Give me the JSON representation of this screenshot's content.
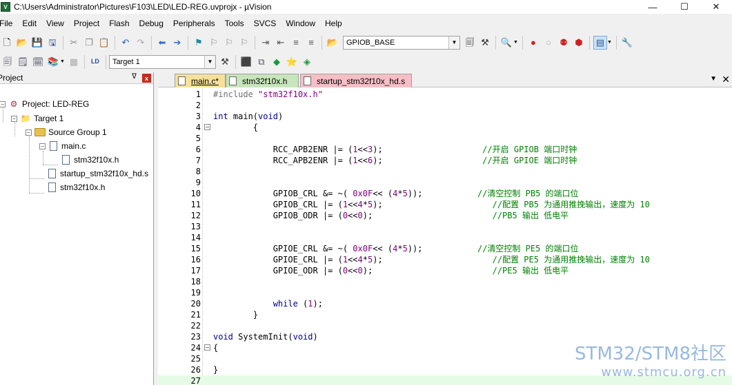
{
  "window": {
    "title": "C:\\Users\\Administrator\\Pictures\\F103\\LED\\LED-REG.uvprojx - µVision",
    "app_icon": "V",
    "min": "—",
    "max": "☐",
    "close": "✕"
  },
  "menu": [
    "File",
    "Edit",
    "View",
    "Project",
    "Flash",
    "Debug",
    "Peripherals",
    "Tools",
    "SVCS",
    "Window",
    "Help"
  ],
  "toolbar1": {
    "find_combo": "GPIOB_BASE"
  },
  "toolbar2": {
    "target_combo": "Target 1"
  },
  "project_panel": {
    "title": "Project",
    "pin": "ᐁ",
    "close": "x",
    "tree": [
      {
        "label": "Project: LED-REG",
        "level": 0,
        "type": "project"
      },
      {
        "label": "Target 1",
        "level": 1,
        "type": "target"
      },
      {
        "label": "Source Group 1",
        "level": 2,
        "type": "folder"
      },
      {
        "label": "main.c",
        "level": 3,
        "type": "file"
      },
      {
        "label": "stm32f10x.h",
        "level": 4,
        "type": "file"
      },
      {
        "label": "startup_stm32f10x_hd.s",
        "level": 3,
        "type": "file"
      },
      {
        "label": "stm32f10x.h",
        "level": 3,
        "type": "file"
      }
    ]
  },
  "tabs": [
    {
      "label": "main.c*"
    },
    {
      "label": "stm32f10x.h"
    },
    {
      "label": "startup_stm32f10x_hd.s"
    }
  ],
  "code": [
    {
      "n": "1",
      "parts": [
        [
          "pre",
          "#include "
        ],
        [
          "str",
          "\"stm32f10x.h\""
        ]
      ]
    },
    {
      "n": "2",
      "parts": []
    },
    {
      "n": "3",
      "parts": [
        [
          "kw",
          "int"
        ],
        [
          "",
          " main("
        ],
        [
          "kw",
          "void"
        ],
        [
          "",
          ")"
        ]
      ]
    },
    {
      "n": "4",
      "fold": true,
      "parts": [
        [
          "",
          "        {"
        ]
      ]
    },
    {
      "n": "5",
      "parts": []
    },
    {
      "n": "6",
      "parts": [
        [
          "",
          "            RCC_APB2ENR |= ("
        ],
        [
          "num",
          "1"
        ],
        [
          "",
          "<<"
        ],
        [
          "num",
          "3"
        ],
        [
          "",
          ");                    "
        ],
        [
          "comment",
          "//开启 GPIOB 端口时钟"
        ]
      ]
    },
    {
      "n": "7",
      "parts": [
        [
          "",
          "            RCC_APB2ENR |= ("
        ],
        [
          "num",
          "1"
        ],
        [
          "",
          "<<"
        ],
        [
          "num",
          "6"
        ],
        [
          "",
          ");                    "
        ],
        [
          "comment",
          "//开启 GPIOE 端口时钟"
        ]
      ]
    },
    {
      "n": "8",
      "parts": []
    },
    {
      "n": "9",
      "parts": []
    },
    {
      "n": "10",
      "parts": [
        [
          "",
          "            GPIOB_CRL &= ~( "
        ],
        [
          "num",
          "0x0F"
        ],
        [
          "",
          "<< ("
        ],
        [
          "num",
          "4"
        ],
        [
          "",
          "*"
        ],
        [
          "num",
          "5"
        ],
        [
          "",
          "));           "
        ],
        [
          "comment",
          "//清空控制 PB5 的端口位"
        ]
      ]
    },
    {
      "n": "11",
      "parts": [
        [
          "",
          "            GPIOB_CRL |= ("
        ],
        [
          "num",
          "1"
        ],
        [
          "",
          "<<"
        ],
        [
          "num",
          "4"
        ],
        [
          "",
          "*"
        ],
        [
          "num",
          "5"
        ],
        [
          "",
          ");                      "
        ],
        [
          "comment",
          "//配置 PB5 为通用推挽输出，速度为 10"
        ]
      ]
    },
    {
      "n": "12",
      "parts": [
        [
          "",
          "            GPIOB_ODR |= ("
        ],
        [
          "num",
          "0"
        ],
        [
          "",
          "<<"
        ],
        [
          "num",
          "0"
        ],
        [
          "",
          ");                        "
        ],
        [
          "comment",
          "//PB5 输出 低电平"
        ]
      ]
    },
    {
      "n": "13",
      "parts": []
    },
    {
      "n": "14",
      "parts": []
    },
    {
      "n": "15",
      "parts": [
        [
          "",
          "            GPIOE_CRL &= ~( "
        ],
        [
          "num",
          "0x0F"
        ],
        [
          "",
          "<< ("
        ],
        [
          "num",
          "4"
        ],
        [
          "",
          "*"
        ],
        [
          "num",
          "5"
        ],
        [
          "",
          "));           "
        ],
        [
          "comment",
          "//清空控制 PE5 的端口位"
        ]
      ]
    },
    {
      "n": "16",
      "parts": [
        [
          "",
          "            GPIOE_CRL |= ("
        ],
        [
          "num",
          "1"
        ],
        [
          "",
          "<<"
        ],
        [
          "num",
          "4"
        ],
        [
          "",
          "*"
        ],
        [
          "num",
          "5"
        ],
        [
          "",
          ");                      "
        ],
        [
          "comment",
          "//配置 PE5 为通用推挽输出，速度为 10"
        ]
      ]
    },
    {
      "n": "17",
      "parts": [
        [
          "",
          "            GPIOE_ODR |= ("
        ],
        [
          "num",
          "0"
        ],
        [
          "",
          "<<"
        ],
        [
          "num",
          "0"
        ],
        [
          "",
          ");                        "
        ],
        [
          "comment",
          "//PE5 输出 低电平"
        ]
      ]
    },
    {
      "n": "18",
      "parts": []
    },
    {
      "n": "19",
      "parts": []
    },
    {
      "n": "20",
      "parts": [
        [
          "",
          "            "
        ],
        [
          "kw",
          "while"
        ],
        [
          "",
          " ("
        ],
        [
          "num",
          "1"
        ],
        [
          "",
          ");"
        ]
      ]
    },
    {
      "n": "21",
      "parts": [
        [
          "",
          "        }"
        ]
      ]
    },
    {
      "n": "22",
      "parts": []
    },
    {
      "n": "23",
      "parts": [
        [
          "kw",
          "void"
        ],
        [
          "",
          " SystemInit("
        ],
        [
          "kw",
          "void"
        ],
        [
          "",
          ")"
        ]
      ]
    },
    {
      "n": "24",
      "fold": true,
      "parts": [
        [
          "",
          "{"
        ]
      ]
    },
    {
      "n": "25",
      "parts": []
    },
    {
      "n": "26",
      "parts": [
        [
          "",
          "}"
        ]
      ]
    },
    {
      "n": "27",
      "current": true,
      "parts": []
    }
  ],
  "watermark": {
    "line1": "STM32/STM8社区",
    "line2": "www.stmcu.org.cn"
  },
  "colors": {
    "tab_main": "#f6e19a",
    "tab_header": "#c7e6bb",
    "tab_startup": "#f6bfc6",
    "comment": "#008000",
    "keyword": "#00008b"
  }
}
